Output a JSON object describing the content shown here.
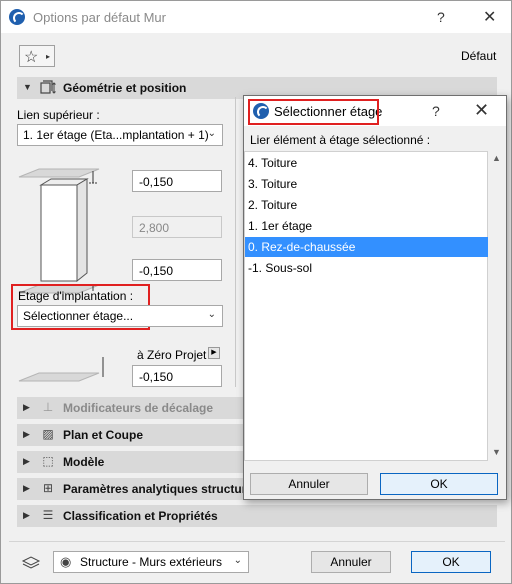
{
  "window": {
    "title": "Options par défaut Mur",
    "help": "?",
    "close": "✕"
  },
  "toolbar": {
    "favorites_star": "☆",
    "favorites_arrow": "▸",
    "default_label": "Défaut"
  },
  "geometry": {
    "section_label": "Géométrie et position",
    "top_link_label": "Lien supérieur :",
    "top_link_value": "1. 1er étage (Eta...mplantation + 1)",
    "top_offset": "-0,150",
    "height": "2,800",
    "bottom_offset": "-0,150",
    "home_story_label": "Etage d'implantation :",
    "home_story_value": "Sélectionner étage...",
    "ref_label": "à Zéro Projet",
    "ref_value": "-0,150"
  },
  "sections": [
    {
      "label": "Modificateurs de décalage",
      "icon": "offset-modifier-icon"
    },
    {
      "label": "Plan et Coupe",
      "icon": "floor-plan-icon"
    },
    {
      "label": "Modèle",
      "icon": "model-icon"
    },
    {
      "label": "Paramètres analytiques structurels",
      "icon": "structural-icon"
    },
    {
      "label": "Classification et Propriétés",
      "icon": "classification-icon"
    }
  ],
  "footer": {
    "layer_value": "Structure - Murs extérieurs",
    "cancel_label": "Annuler",
    "ok_label": "OK"
  },
  "dialog": {
    "title": "Sélectionner étage",
    "help": "?",
    "close": "✕",
    "subtitle": "Lier élément à étage sélectionné :",
    "stories": [
      "4. Toiture",
      "3. Toiture",
      "2. Toiture",
      "1. 1er étage",
      "0. Rez-de-chaussée",
      "-1. Sous-sol"
    ],
    "selected_index": 4,
    "cancel_label": "Annuler",
    "ok_label": "OK"
  },
  "colors": {
    "highlight": "#e02020",
    "selection": "#3390ff",
    "accent": "#1f5fae"
  }
}
